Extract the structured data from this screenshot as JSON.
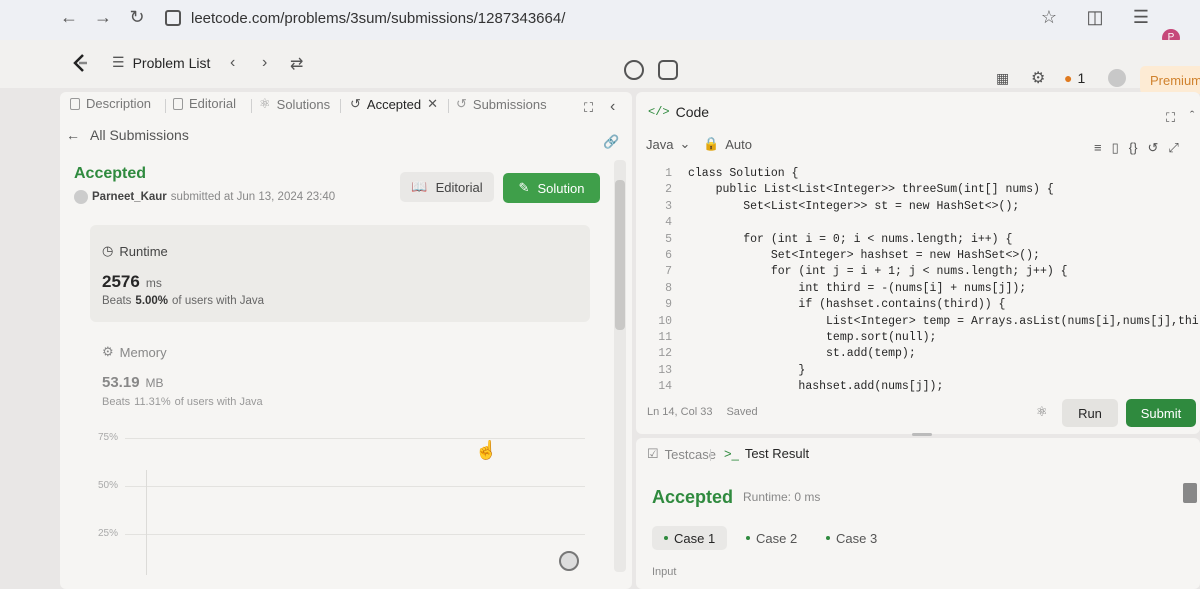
{
  "browser": {
    "url": "leetcode.com/problems/3sum/submissions/1287343664/",
    "profile_initial": "P"
  },
  "header": {
    "problem_list": "Problem List",
    "streak_count": "1",
    "premium": "Premium"
  },
  "left_tabs": {
    "description": "Description",
    "editorial": "Editorial",
    "solutions": "Solutions",
    "accepted": "Accepted",
    "submissions": "Submissions"
  },
  "submission": {
    "back_link": "All Submissions",
    "status": "Accepted",
    "author": "Parneet_Kaur",
    "submitted_text": "submitted at Jun 13, 2024 23:40",
    "editorial_btn": "Editorial",
    "solution_btn": "Solution",
    "runtime_label": "Runtime",
    "runtime_value": "2576",
    "runtime_unit": "ms",
    "runtime_beats_prefix": "Beats",
    "runtime_beats_pct": "5.00%",
    "runtime_beats_suffix": "of users with Java",
    "memory_label": "Memory",
    "memory_value": "53.19",
    "memory_unit": "MB",
    "memory_beats_prefix": "Beats",
    "memory_beats_pct": "11.31%",
    "memory_beats_suffix": "of users with Java",
    "chart_ticks": [
      "75%",
      "50%",
      "25%"
    ]
  },
  "code": {
    "tab_label": "Code",
    "language": "Java",
    "mode": "Auto",
    "lines": [
      {
        "n": "1",
        "t": "class Solution {"
      },
      {
        "n": "2",
        "t": "    public List<List<Integer>> threeSum(int[] nums) {"
      },
      {
        "n": "3",
        "t": "        Set<List<Integer>> st = new HashSet<>();"
      },
      {
        "n": "4",
        "t": ""
      },
      {
        "n": "5",
        "t": "        for (int i = 0; i < nums.length; i++) {"
      },
      {
        "n": "6",
        "t": "            Set<Integer> hashset = new HashSet<>();"
      },
      {
        "n": "7",
        "t": "            for (int j = i + 1; j < nums.length; j++) {"
      },
      {
        "n": "8",
        "t": "                int third = -(nums[i] + nums[j]);"
      },
      {
        "n": "9",
        "t": "                if (hashset.contains(third)) {"
      },
      {
        "n": "10",
        "t": "                    List<Integer> temp = Arrays.asList(nums[i],nums[j],third);"
      },
      {
        "n": "11",
        "t": "                    temp.sort(null);"
      },
      {
        "n": "12",
        "t": "                    st.add(temp);"
      },
      {
        "n": "13",
        "t": "                }"
      },
      {
        "n": "14",
        "t": "                hashset.add(nums[j]);"
      }
    ],
    "status": "Ln 14, Col 33",
    "saved": "Saved",
    "run_btn": "Run",
    "submit_btn": "Submit"
  },
  "test": {
    "testcase_tab": "Testcase",
    "result_tab": "Test Result",
    "result": "Accepted",
    "runtime": "Runtime: 0 ms",
    "cases": [
      "Case 1",
      "Case 2",
      "Case 3"
    ],
    "input_label": "Input"
  }
}
